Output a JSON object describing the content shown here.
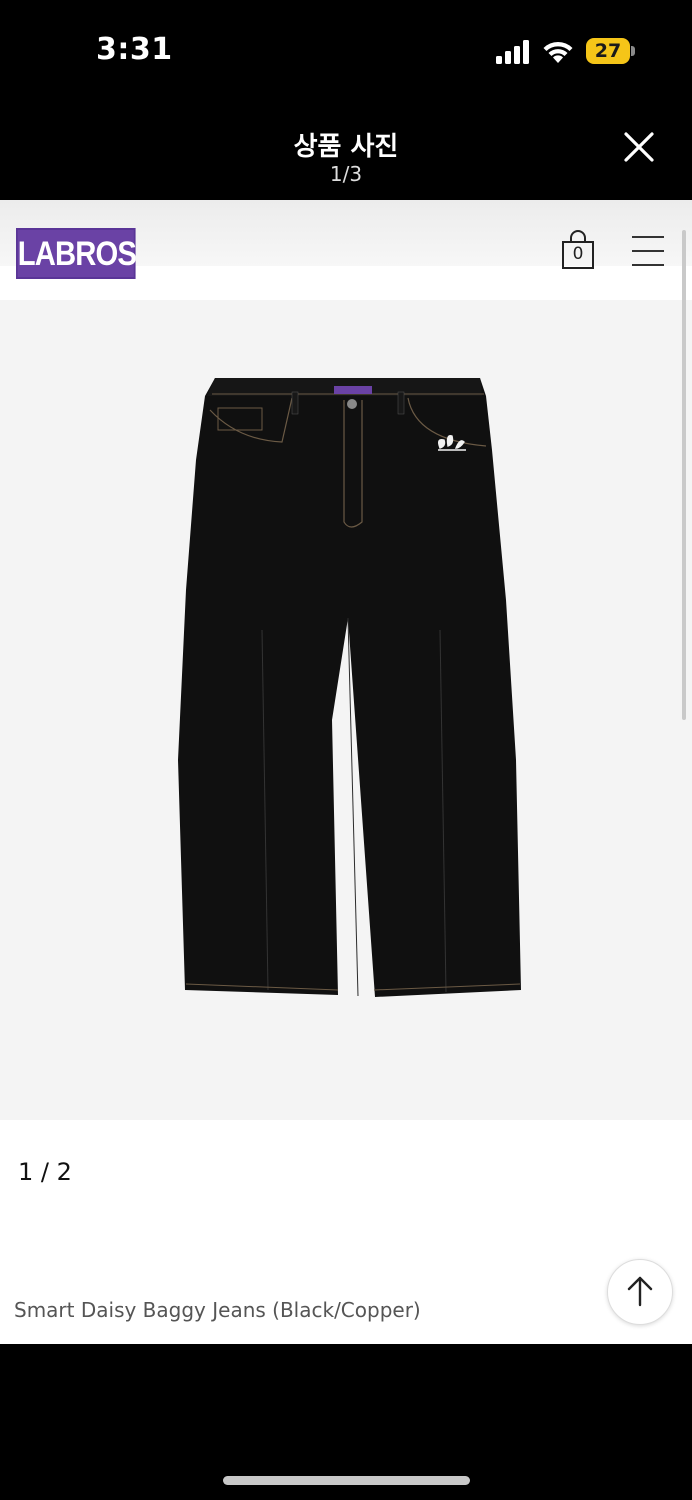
{
  "status_bar": {
    "time": "3:31",
    "battery": "27"
  },
  "viewer": {
    "title": "상품 사진",
    "counter": "1/3"
  },
  "site": {
    "logo": "LABROS",
    "cart_count": "0"
  },
  "product": {
    "image_counter": "1 / 2",
    "name": "Smart Daisy Baggy Jeans (Black/Copper)"
  },
  "icons": {
    "signal": "cellular-signal-icon",
    "wifi": "wifi-icon",
    "close": "close-icon",
    "cart": "shopping-bag-icon",
    "menu": "hamburger-menu-icon",
    "scroll_top": "arrow-up-icon"
  },
  "colors": {
    "brand": "#6a42a5",
    "battery": "#f5c518"
  }
}
